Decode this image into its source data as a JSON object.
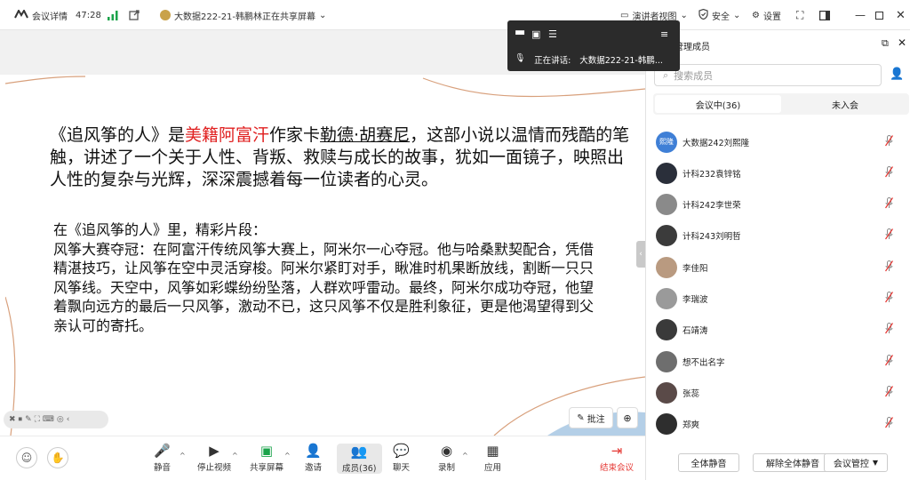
{
  "topbar": {
    "meeting_details": "会议详情",
    "duration": "47:28",
    "sharing": "大数据222-21-韩鹏林正在共享屏幕",
    "presenter_view": "演讲者视图",
    "security": "安全",
    "settings": "设置"
  },
  "float_panel": {
    "speaking_label": "正在讲话:",
    "speaking_name": "大数据222-21-韩鹏..."
  },
  "slide": {
    "intro": {
      "p1": "《追风筝的人》是",
      "p2_red": "美籍阿富汗",
      "p3": "作家卡",
      "p4_ul": "勒德·胡赛尼",
      "p5": "，这部小说以温情而残酷的笔触，讲述了一个关于人性、背叛、救赎与成长的故事，犹如一面镜子，映照出人性的复杂与光辉，深深震撼着每一位读者的心灵。"
    },
    "excerpt_heading": "在《追风筝的人》里，精彩片段：",
    "excerpt_body": "风筝大赛夺冠：在阿富汗传统风筝大赛上，阿米尔一心夺冠。他与哈桑默契配合，凭借精湛技巧，让风筝在空中灵活穿梭。阿米尔紧盯对手，瞅准时机果断放线，割断一只只风筝线。天空中，风筝如彩蝶纷纷坠落，人群欢呼雷动。最终，阿米尔成功夺冠，他望着飘向远方的最后一只风筝，激动不已，这只风筝不仅是胜利象征，更是他渴望得到父亲认可的寄托。"
  },
  "annotate_label": "批注",
  "toolbar": {
    "mute": "静音",
    "stop_video": "停止视频",
    "share_screen": "共享屏幕",
    "invite": "邀请",
    "members": "成员(36)",
    "chat": "聊天",
    "record": "录制",
    "apps": "应用",
    "end_meeting": "结束会议"
  },
  "panel": {
    "title": "管理成员",
    "search_placeholder": "搜索成员",
    "tab_in_meeting": "会议中(36)",
    "tab_not_joined": "未入会",
    "members": [
      {
        "name": "大数据242刘熙隆",
        "avatar_text": "熙隆",
        "color": "#3f7fd6"
      },
      {
        "name": "计科232袁锌铭",
        "avatar_text": "",
        "color": "#2a2f3a"
      },
      {
        "name": "计科242李世荣",
        "avatar_text": "",
        "color": "#8a8a8a"
      },
      {
        "name": "计科243刘明哲",
        "avatar_text": "",
        "color": "#3b3b3b"
      },
      {
        "name": "李佳阳",
        "avatar_text": "",
        "color": "#b99a80"
      },
      {
        "name": "李瑞波",
        "avatar_text": "",
        "color": "#9a9a9a"
      },
      {
        "name": "石靖涛",
        "avatar_text": "",
        "color": "#3a3a3a"
      },
      {
        "name": "想不出名字",
        "avatar_text": "",
        "color": "#6e6e6e"
      },
      {
        "name": "张蕊",
        "avatar_text": "",
        "color": "#5a4a48"
      },
      {
        "name": "郑爽",
        "avatar_text": "",
        "color": "#2e2e2e"
      }
    ],
    "mute_all": "全体静音",
    "unmute_all": "解除全体静音",
    "meeting_control": "会议管控"
  }
}
